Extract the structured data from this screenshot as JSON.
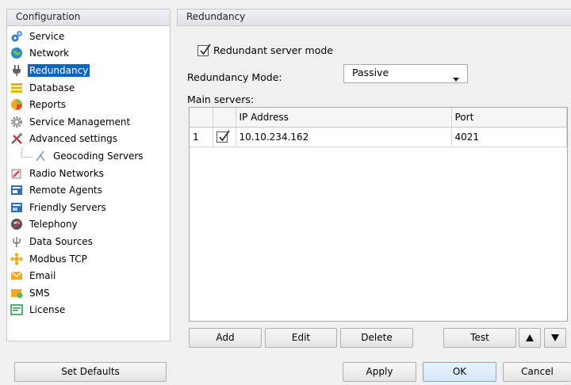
{
  "left_header": "Configuration",
  "right_header": "Redundancy",
  "nav": {
    "items": [
      {
        "label": "Service",
        "icon": "service-gears-icon"
      },
      {
        "label": "Network",
        "icon": "network-globe-icon"
      },
      {
        "label": "Redundancy",
        "icon": "redundancy-plug-icon",
        "selected": true
      },
      {
        "label": "Database",
        "icon": "database-icon"
      },
      {
        "label": "Reports",
        "icon": "reports-icon"
      },
      {
        "label": "Service Management",
        "icon": "service-management-gear-icon"
      },
      {
        "label": "Advanced settings",
        "icon": "advanced-settings-tools-icon"
      },
      {
        "label": "Geocoding Servers",
        "icon": "geocoding-icon",
        "sub": true
      },
      {
        "label": "Radio Networks",
        "icon": "radio-networks-icon"
      },
      {
        "label": "Remote Agents",
        "icon": "remote-agents-icon"
      },
      {
        "label": "Friendly Servers",
        "icon": "friendly-servers-icon"
      },
      {
        "label": "Telephony",
        "icon": "telephony-icon"
      },
      {
        "label": "Data Sources",
        "icon": "data-sources-icon"
      },
      {
        "label": "Modbus TCP",
        "icon": "modbus-icon"
      },
      {
        "label": "Email",
        "icon": "email-icon"
      },
      {
        "label": "SMS",
        "icon": "sms-icon"
      },
      {
        "label": "License",
        "icon": "license-icon"
      }
    ]
  },
  "redundancy": {
    "redundant_mode_label": "Redundant server mode",
    "redundant_mode_checked": true,
    "mode_label": "Redundancy Mode:",
    "mode_value": "Passive",
    "servers_label": "Main servers:",
    "columns": [
      "",
      "",
      "IP Address",
      "Port"
    ],
    "rows": [
      {
        "index": "1",
        "checked": true,
        "ip": "10.10.234.162",
        "port": "4021"
      }
    ]
  },
  "buttons": {
    "add": "Add",
    "edit": "Edit",
    "delete": "Delete",
    "test": "Test",
    "set_defaults": "Set Defaults",
    "apply": "Apply",
    "ok": "OK",
    "cancel": "Cancel"
  },
  "colors": {
    "selection": "#0a64c8",
    "header_bg": "#e6e9ed",
    "ok_button": "#d6e6f8"
  }
}
